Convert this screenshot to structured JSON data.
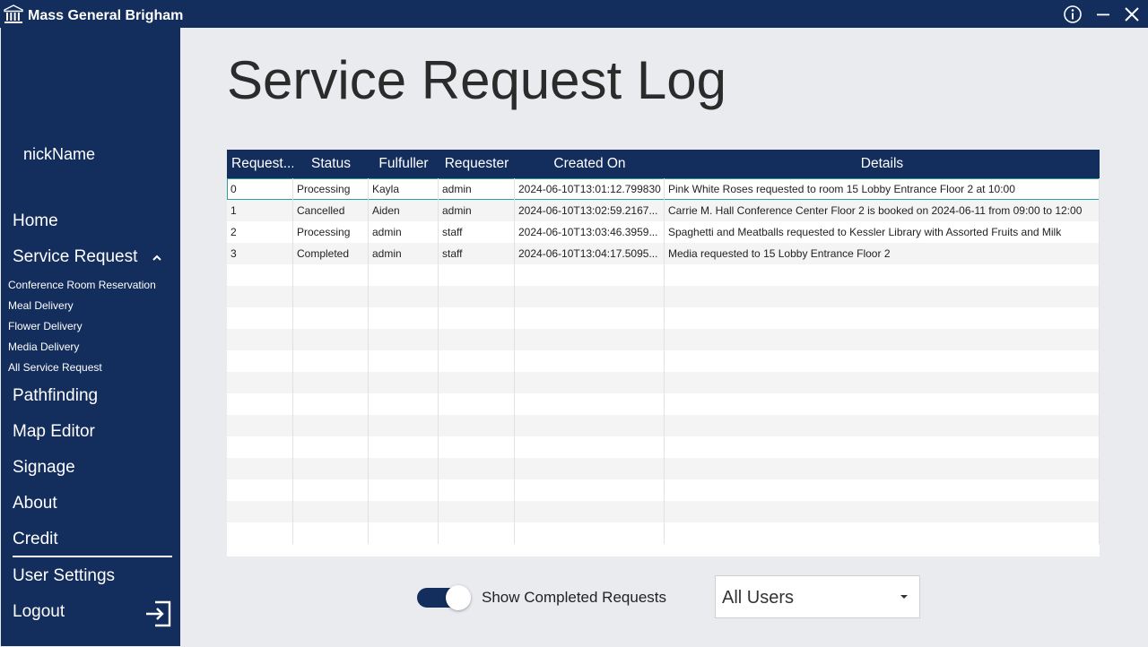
{
  "app": {
    "name": "Mass General Brigham",
    "icons": [
      "bank-logo-icon",
      "info-icon",
      "minimize-icon",
      "close-icon"
    ]
  },
  "sidebar": {
    "username": "nickName",
    "nav": {
      "home": "Home",
      "service_request": "Service Request",
      "pathfinding": "Pathfinding",
      "map_editor": "Map Editor",
      "signage": "Signage",
      "about": "About",
      "credit": "Credit",
      "user_settings": "User Settings",
      "logout": "Logout"
    },
    "sub_items": [
      "Conference Room Reservation",
      "Meal Delivery",
      "Flower Delivery",
      "Media Delivery",
      "All Service Request"
    ]
  },
  "main": {
    "title": "Service Request Log"
  },
  "table": {
    "columns": [
      "Request...",
      "Status",
      "Fulfuller",
      "Requester",
      "Created On",
      "Details"
    ],
    "rows": [
      [
        "0",
        "Processing",
        "Kayla",
        "admin",
        "2024-06-10T13:01:12.799830",
        "Pink White Roses requested to room 15 Lobby Entrance Floor 2 at 10:00"
      ],
      [
        "1",
        "Cancelled",
        "Aiden",
        "admin",
        "2024-06-10T13:02:59.2167...",
        "Carrie M. Hall Conference Center Floor 2 is booked on 2024-06-11 from 09:00 to 12:00"
      ],
      [
        "2",
        "Processing",
        "admin",
        "staff",
        "2024-06-10T13:03:46.3959...",
        "Spaghetti and Meatballs requested to Kessler Library with Assorted Fruits and Milk"
      ],
      [
        "3",
        "Completed",
        "admin",
        "staff",
        "2024-06-10T13:04:17.5095...",
        "Media requested to 15 Lobby Entrance Floor 2"
      ]
    ]
  },
  "controls": {
    "show_completed_label": "Show Completed Requests",
    "show_completed_on": true,
    "user_filter": "All Users"
  },
  "colors": {
    "navy": "#132d5c",
    "background": "#e9ebef",
    "selection": "#2a9d9d"
  }
}
